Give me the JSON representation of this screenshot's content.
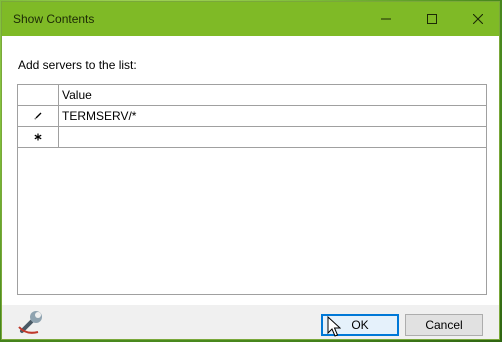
{
  "window": {
    "title": "Show Contents"
  },
  "icons": {
    "minimize": "minimize-icon",
    "maximize": "maximize-icon",
    "close": "close-icon",
    "edit_row": "pencil-icon",
    "new_row": "asterisk-icon",
    "logo": "wrench-icon",
    "cursor": "mouse-cursor-icon"
  },
  "content": {
    "prompt": "Add servers to the list:"
  },
  "grid": {
    "columns": [
      "Value"
    ],
    "rows": [
      {
        "marker": "pencil",
        "value": "TERMSERV/*"
      },
      {
        "marker": "new",
        "value": ""
      }
    ]
  },
  "buttons": {
    "ok": "OK",
    "cancel": "Cancel"
  },
  "colors": {
    "titlebar": "#7fba26",
    "ok_accent": "#0078d7"
  }
}
